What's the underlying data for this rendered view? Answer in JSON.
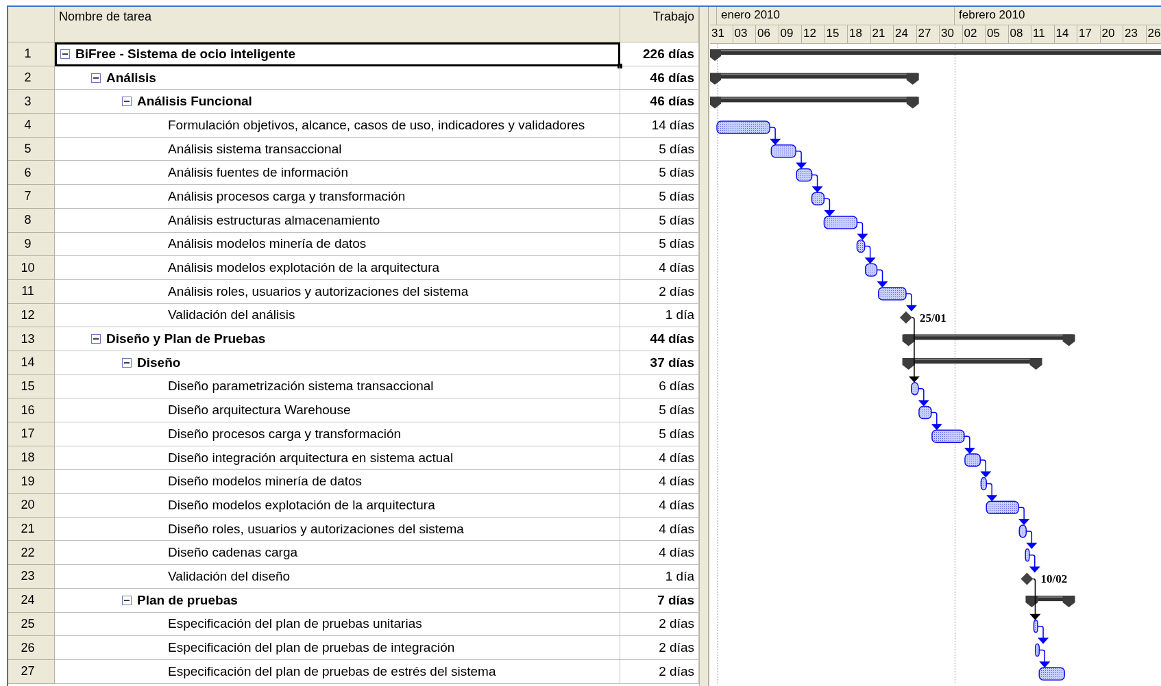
{
  "columns": {
    "name": "Nombre de tarea",
    "work": "Trabajo"
  },
  "timescale": {
    "months": [
      "enero 2010",
      "febrero 2010"
    ],
    "days": [
      "31",
      "03",
      "06",
      "09",
      "12",
      "15",
      "18",
      "21",
      "24",
      "27",
      "30",
      "02",
      "05",
      "08",
      "11",
      "14",
      "17",
      "20",
      "23",
      "26"
    ]
  },
  "tasks": [
    {
      "number": "1",
      "name": "BiFree - Sistema de ocio inteligente",
      "work": "226 días",
      "kind": "summary",
      "expanded": true,
      "selected": true,
      "children": [
        {
          "number": "2",
          "name": "Análisis",
          "work": "46 días",
          "kind": "summary",
          "expanded": true,
          "selected": false,
          "children": [
            {
              "number": "3",
              "name": "Análisis Funcional",
              "work": "46 días",
              "kind": "summary",
              "expanded": true,
              "selected": false,
              "children": [
                {
                  "number": "4",
                  "name": "Formulación objetivos, alcance, casos de uso, indicadores y validadores",
                  "work": "14 días",
                  "kind": "task",
                  "selected": false
                },
                {
                  "number": "5",
                  "name": "Análisis sistema transaccional",
                  "work": "5 días",
                  "kind": "task",
                  "selected": false
                },
                {
                  "number": "6",
                  "name": "Análisis fuentes de información",
                  "work": "5 días",
                  "kind": "task",
                  "selected": false
                },
                {
                  "number": "7",
                  "name": "Análisis procesos carga y transformación",
                  "work": "5 días",
                  "kind": "task",
                  "selected": false
                },
                {
                  "number": "8",
                  "name": "Análisis estructuras almacenamiento",
                  "work": "5 días",
                  "kind": "task",
                  "selected": false
                },
                {
                  "number": "9",
                  "name": "Análisis modelos minería de datos",
                  "work": "5 días",
                  "kind": "task",
                  "selected": false
                },
                {
                  "number": "10",
                  "name": "Análisis modelos explotación de la arquitectura",
                  "work": "4 días",
                  "kind": "task",
                  "selected": false
                },
                {
                  "number": "11",
                  "name": "Análisis roles, usuarios y autorizaciones del sistema",
                  "work": "2 días",
                  "kind": "task",
                  "selected": false
                },
                {
                  "number": "12",
                  "name": "Validación del análisis",
                  "work": "1 día",
                  "kind": "milestone",
                  "milestone_label": "25/01",
                  "selected": false
                }
              ]
            }
          ]
        },
        {
          "number": "13",
          "name": "Diseño y Plan de Pruebas",
          "work": "44 días",
          "kind": "summary",
          "expanded": true,
          "selected": false,
          "children": [
            {
              "number": "14",
              "name": "Diseño",
              "work": "37 días",
              "kind": "summary",
              "expanded": true,
              "selected": false,
              "children": [
                {
                  "number": "15",
                  "name": "Diseño parametrización sistema transaccional",
                  "work": "6 días",
                  "kind": "task",
                  "selected": false
                },
                {
                  "number": "16",
                  "name": "Diseño arquitectura Warehouse",
                  "work": "5 días",
                  "kind": "task",
                  "selected": false
                },
                {
                  "number": "17",
                  "name": "Diseño procesos carga y transformación",
                  "work": "5 días",
                  "kind": "task",
                  "selected": false
                },
                {
                  "number": "18",
                  "name": "Diseño integración arquitectura en sistema actual",
                  "work": "4 días",
                  "kind": "task",
                  "selected": false
                },
                {
                  "number": "19",
                  "name": "Diseño modelos minería de datos",
                  "work": "4 días",
                  "kind": "task",
                  "selected": false
                },
                {
                  "number": "20",
                  "name": "Diseño modelos explotación de la arquitectura",
                  "work": "4 días",
                  "kind": "task",
                  "selected": false
                },
                {
                  "number": "21",
                  "name": "Diseño roles, usuarios y autorizaciones del sistema",
                  "work": "4 días",
                  "kind": "task",
                  "selected": false
                },
                {
                  "number": "22",
                  "name": "Diseño cadenas carga",
                  "work": "4 días",
                  "kind": "task",
                  "selected": false
                },
                {
                  "number": "23",
                  "name": "Validación del diseño",
                  "work": "1 día",
                  "kind": "milestone",
                  "milestone_label": "10/02",
                  "selected": false
                }
              ]
            },
            {
              "number": "24",
              "name": "Plan de pruebas",
              "work": "7 días",
              "kind": "summary",
              "expanded": true,
              "selected": false,
              "children": [
                {
                  "number": "25",
                  "name": "Especificación del plan de pruebas unitarias",
                  "work": "2 días",
                  "kind": "task",
                  "selected": false
                },
                {
                  "number": "26",
                  "name": "Especificación del plan de pruebas de integración",
                  "work": "2 días",
                  "kind": "task",
                  "selected": false
                },
                {
                  "number": "27",
                  "name": "Especificación del plan de pruebas de estrés del sistema",
                  "work": "2 días",
                  "kind": "task",
                  "selected": false
                }
              ]
            }
          ]
        }
      ]
    }
  ]
}
